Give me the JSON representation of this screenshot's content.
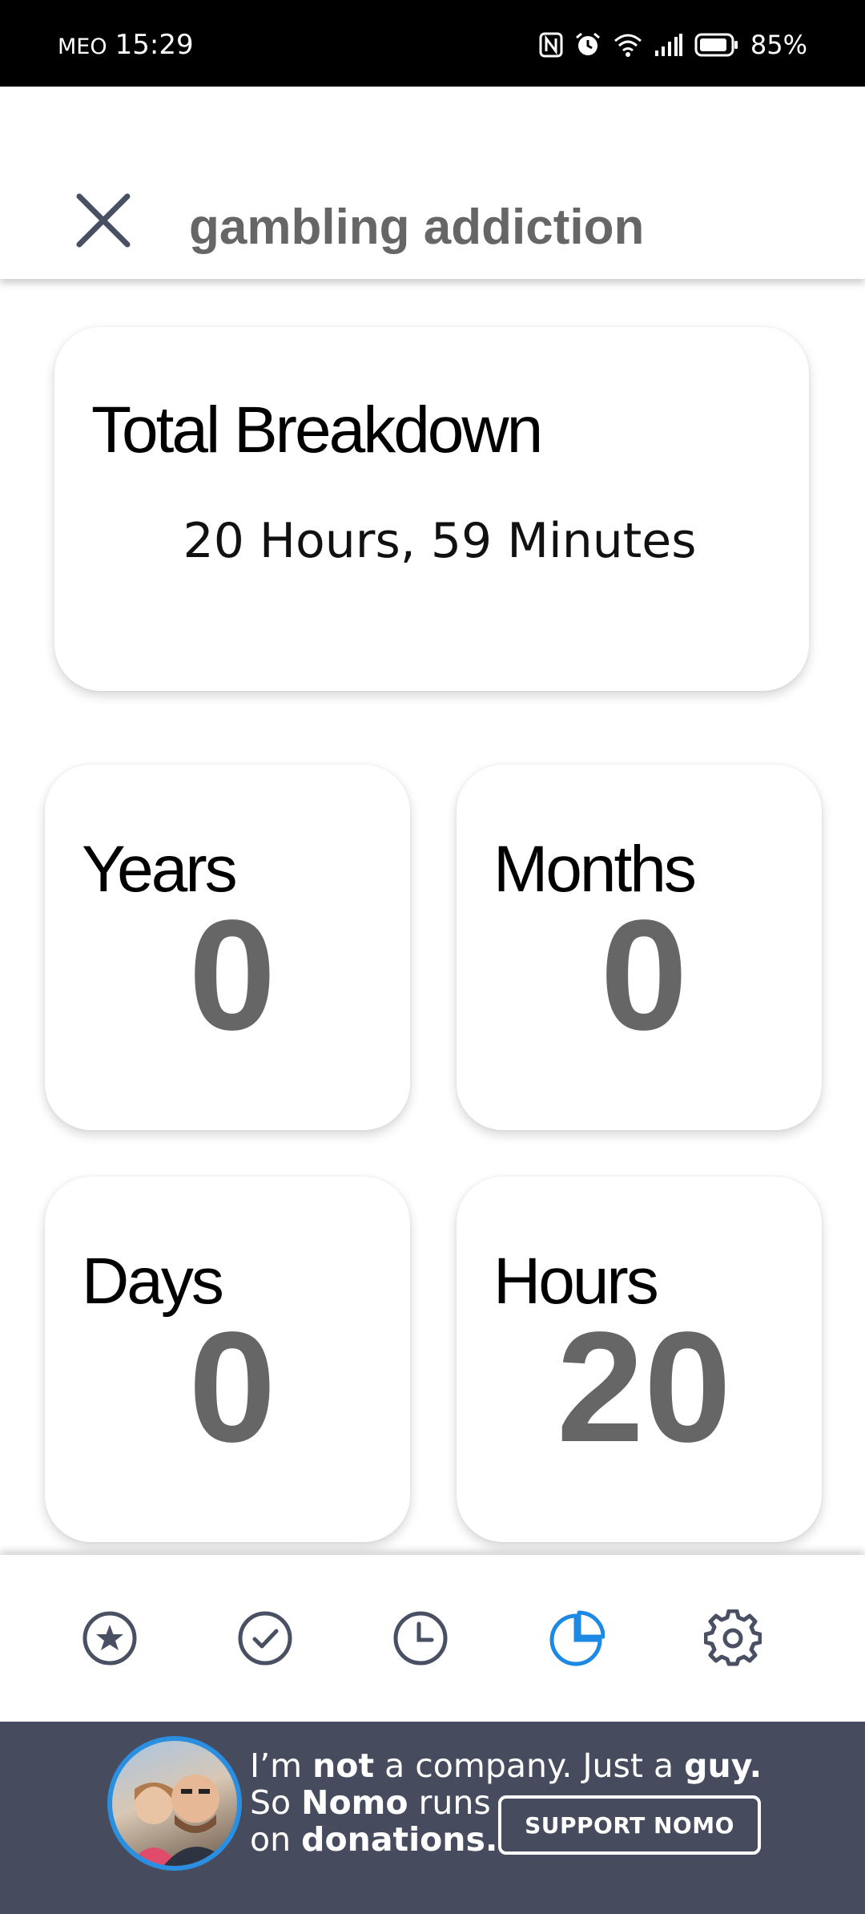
{
  "status_bar": {
    "carrier": "MEO",
    "time": "15:29",
    "battery": "85%",
    "icons": [
      "nfc-icon",
      "alarm-icon",
      "wifi-icon",
      "signal-icon",
      "battery-icon"
    ]
  },
  "header": {
    "title": "gambling addiction",
    "close_icon": "close-icon"
  },
  "total": {
    "title": "Total Breakdown",
    "value": "20 Hours, 59 Minutes"
  },
  "stats": [
    {
      "label": "Years",
      "value": "0"
    },
    {
      "label": "Months",
      "value": "0"
    },
    {
      "label": "Days",
      "value": "0"
    },
    {
      "label": "Hours",
      "value": "20"
    }
  ],
  "bottom_nav": {
    "items": [
      {
        "icon": "star-icon",
        "active": false
      },
      {
        "icon": "check-circle-icon",
        "active": false
      },
      {
        "icon": "clock-icon",
        "active": false
      },
      {
        "icon": "pie-chart-icon",
        "active": true
      },
      {
        "icon": "gear-icon",
        "active": false
      }
    ],
    "active_color": "#1e88e5",
    "inactive_color": "#4a5064"
  },
  "banner": {
    "line1_a": "I’m ",
    "line1_b": "not",
    "line1_c": " a company. Just a ",
    "line1_d": "guy.",
    "line2_a": "So ",
    "line2_b": "Nomo",
    "line2_c": " runs",
    "line3_a": "on ",
    "line3_b": "donations.",
    "button": "SUPPORT NOMO",
    "background": "#464b5e"
  }
}
